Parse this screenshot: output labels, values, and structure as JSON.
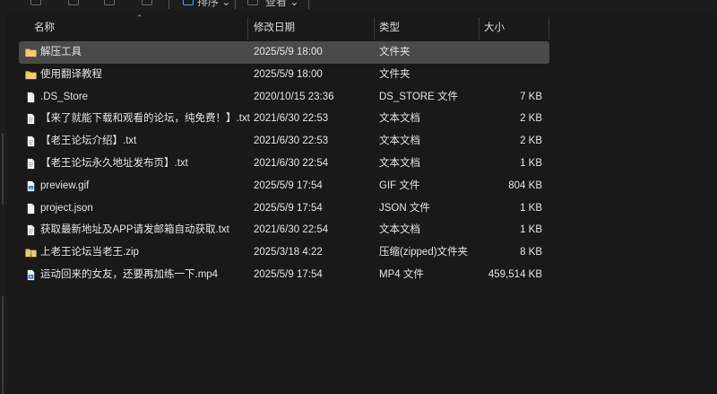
{
  "toolbar": {
    "sort_label": "排序",
    "view_label": "查看",
    "more_label": "···"
  },
  "columns": {
    "name": "名称",
    "date": "修改日期",
    "type": "类型",
    "size": "大小"
  },
  "files": [
    {
      "name": "解压工具",
      "date": "2025/5/9 18:00",
      "type": "文件夹",
      "size": "",
      "icon": "folder-icon",
      "selected": true
    },
    {
      "name": "使用翻译教程",
      "date": "2025/5/9 18:00",
      "type": "文件夹",
      "size": "",
      "icon": "folder-icon",
      "selected": false
    },
    {
      "name": ".DS_Store",
      "date": "2020/10/15 23:36",
      "type": "DS_STORE 文件",
      "size": "7 KB",
      "icon": "file-icon",
      "selected": false
    },
    {
      "name": "【来了就能下载和观看的论坛，纯免费！】.txt",
      "date": "2021/6/30 22:53",
      "type": "文本文档",
      "size": "2 KB",
      "icon": "text-file-icon",
      "selected": false
    },
    {
      "name": "【老王论坛介绍】.txt",
      "date": "2021/6/30 22:53",
      "type": "文本文档",
      "size": "2 KB",
      "icon": "text-file-icon",
      "selected": false
    },
    {
      "name": "【老王论坛永久地址发布页】.txt",
      "date": "2021/6/30 22:54",
      "type": "文本文档",
      "size": "1 KB",
      "icon": "text-file-icon",
      "selected": false
    },
    {
      "name": "preview.gif",
      "date": "2025/5/9 17:54",
      "type": "GIF 文件",
      "size": "804 KB",
      "icon": "image-file-icon",
      "selected": false
    },
    {
      "name": "project.json",
      "date": "2025/5/9 17:54",
      "type": "JSON 文件",
      "size": "1 KB",
      "icon": "file-icon",
      "selected": false
    },
    {
      "name": "获取最新地址及APP请发邮箱自动获取.txt",
      "date": "2021/6/30 22:54",
      "type": "文本文档",
      "size": "1 KB",
      "icon": "text-file-icon",
      "selected": false
    },
    {
      "name": "上老王论坛当老王.zip",
      "date": "2025/3/18 4:22",
      "type": "压缩(zipped)文件夹",
      "size": "8 KB",
      "icon": "zip-folder-icon",
      "selected": false
    },
    {
      "name": "运动回来的女友，还要再加练一下.mp4",
      "date": "2025/5/9 17:54",
      "type": "MP4 文件",
      "size": "459,514 KB",
      "icon": "video-file-icon",
      "selected": false
    }
  ]
}
